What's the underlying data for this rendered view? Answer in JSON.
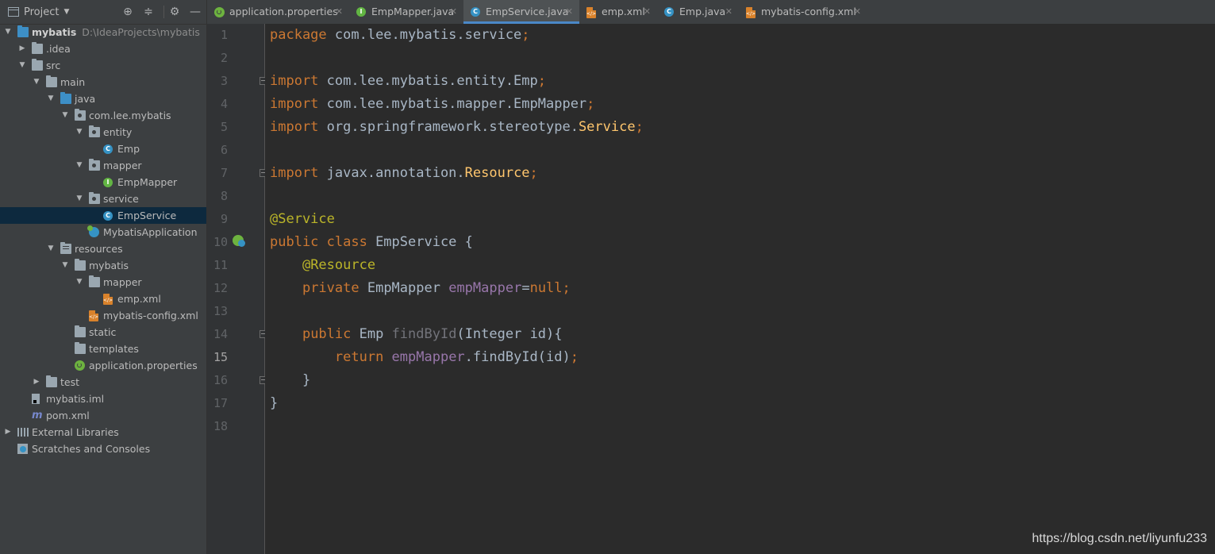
{
  "project_panel": {
    "title": "Project",
    "tools": [
      "⊕",
      "≑",
      "⚙",
      "—"
    ],
    "tree": [
      {
        "label": "mybatis",
        "hint": "D:\\IdeaProjects\\mybatis",
        "depth": 0,
        "arrow": "down",
        "icon": "module-folder-icon",
        "bold": true
      },
      {
        "label": ".idea",
        "depth": 1,
        "arrow": "right",
        "icon": "folder-icon"
      },
      {
        "label": "src",
        "depth": 1,
        "arrow": "down",
        "icon": "folder-icon"
      },
      {
        "label": "main",
        "depth": 2,
        "arrow": "down",
        "icon": "folder-icon"
      },
      {
        "label": "java",
        "depth": 3,
        "arrow": "down",
        "icon": "source-folder-icon"
      },
      {
        "label": "com.lee.mybatis",
        "depth": 4,
        "arrow": "down",
        "icon": "package-icon"
      },
      {
        "label": "entity",
        "depth": 5,
        "arrow": "down",
        "icon": "package-icon"
      },
      {
        "label": "Emp",
        "depth": 6,
        "arrow": "",
        "icon": "class-icon"
      },
      {
        "label": "mapper",
        "depth": 5,
        "arrow": "down",
        "icon": "package-icon"
      },
      {
        "label": "EmpMapper",
        "depth": 6,
        "arrow": "",
        "icon": "interface-icon"
      },
      {
        "label": "service",
        "depth": 5,
        "arrow": "down",
        "icon": "package-icon"
      },
      {
        "label": "EmpService",
        "depth": 6,
        "arrow": "",
        "icon": "class-icon",
        "selected": true
      },
      {
        "label": "MybatisApplication",
        "depth": 5,
        "arrow": "",
        "icon": "spring-class-icon"
      },
      {
        "label": "resources",
        "depth": 3,
        "arrow": "down",
        "icon": "resources-folder-icon"
      },
      {
        "label": "mybatis",
        "depth": 4,
        "arrow": "down",
        "icon": "folder-icon"
      },
      {
        "label": "mapper",
        "depth": 5,
        "arrow": "down",
        "icon": "folder-icon"
      },
      {
        "label": "emp.xml",
        "depth": 6,
        "arrow": "",
        "icon": "xml-file-icon"
      },
      {
        "label": "mybatis-config.xml",
        "depth": 5,
        "arrow": "",
        "icon": "xml-file-icon"
      },
      {
        "label": "static",
        "depth": 4,
        "arrow": "",
        "icon": "folder-icon"
      },
      {
        "label": "templates",
        "depth": 4,
        "arrow": "",
        "icon": "folder-icon"
      },
      {
        "label": "application.properties",
        "depth": 4,
        "arrow": "",
        "icon": "spring-properties-icon"
      },
      {
        "label": "test",
        "depth": 2,
        "arrow": "right",
        "icon": "folder-icon"
      },
      {
        "label": "mybatis.iml",
        "depth": 1,
        "arrow": "",
        "icon": "iml-file-icon"
      },
      {
        "label": "pom.xml",
        "depth": 1,
        "arrow": "",
        "icon": "maven-icon"
      },
      {
        "label": "External Libraries",
        "depth": 0,
        "arrow": "right",
        "icon": "libraries-icon"
      },
      {
        "label": "Scratches and Consoles",
        "depth": 0,
        "arrow": "",
        "icon": "scratches-icon"
      }
    ]
  },
  "tabs": [
    {
      "label": "application.properties",
      "icon": "spring-properties-icon",
      "close": "✕"
    },
    {
      "label": "EmpMapper.java",
      "icon": "interface-icon",
      "close": "✕"
    },
    {
      "label": "EmpService.java",
      "icon": "class-icon",
      "close": "✕",
      "active": true
    },
    {
      "label": "emp.xml",
      "icon": "xml-file-icon",
      "close": "✕"
    },
    {
      "label": "Emp.java",
      "icon": "class-icon",
      "close": "✕"
    },
    {
      "label": "mybatis-config.xml",
      "icon": "xml-file-icon",
      "close": "✕"
    }
  ],
  "editor": {
    "current_line": 15,
    "lines": [
      [
        [
          "kw",
          "package "
        ],
        [
          "",
          "com.lee.mybatis.service"
        ],
        [
          "kw",
          ";"
        ]
      ],
      [],
      [
        [
          "kw",
          "import "
        ],
        [
          "",
          "com.lee.mybatis.entity.Emp"
        ],
        [
          "kw",
          ";"
        ]
      ],
      [
        [
          "kw",
          "import "
        ],
        [
          "",
          "com.lee.mybatis.mapper.EmpMapper"
        ],
        [
          "kw",
          ";"
        ]
      ],
      [
        [
          "kw",
          "import "
        ],
        [
          "",
          "org.springframework.stereotype."
        ],
        [
          "mth",
          "Service"
        ],
        [
          "kw",
          ";"
        ]
      ],
      [],
      [
        [
          "kw",
          "import "
        ],
        [
          "",
          "javax.annotation."
        ],
        [
          "mth",
          "Resource"
        ],
        [
          "kw",
          ";"
        ]
      ],
      [],
      [
        [
          "ann",
          "@Service"
        ]
      ],
      [
        [
          "kw",
          "public class "
        ],
        [
          "",
          "EmpService {"
        ]
      ],
      [
        [
          "",
          "    "
        ],
        [
          "ann",
          "@Resource"
        ]
      ],
      [
        [
          "",
          "    "
        ],
        [
          "kw",
          "private "
        ],
        [
          "",
          "EmpMapper "
        ],
        [
          "fld",
          "empMapper"
        ],
        [
          "",
          "="
        ],
        [
          "kw",
          "null;"
        ]
      ],
      [],
      [
        [
          "",
          "    "
        ],
        [
          "kw",
          "public "
        ],
        [
          "",
          "Emp "
        ],
        [
          "unused",
          "findById"
        ],
        [
          "",
          "(Integer id){"
        ]
      ],
      [
        [
          "",
          "        "
        ],
        [
          "kw",
          "return "
        ],
        [
          "fld",
          "empMapper"
        ],
        [
          "",
          ".findById(id)"
        ],
        [
          "kw",
          ";"
        ]
      ],
      [
        [
          "",
          "    }"
        ]
      ],
      [
        [
          "",
          "}"
        ]
      ],
      []
    ]
  },
  "watermark": "https://blog.csdn.net/liyunfu233"
}
